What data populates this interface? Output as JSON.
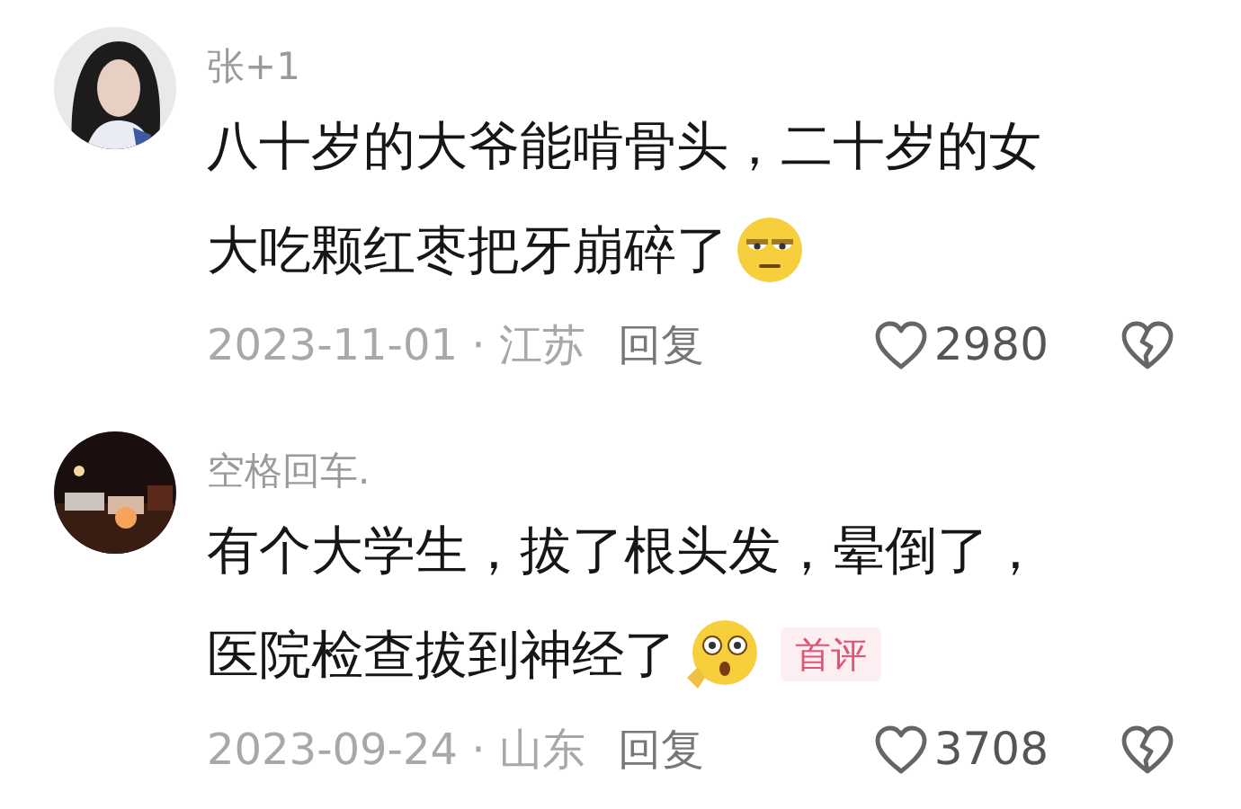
{
  "comments": [
    {
      "username": "张+1",
      "lines": [
        "八十岁的大爷能啃骨头，二十岁的女",
        "大吃颗红枣把牙崩碎了"
      ],
      "emoji": {
        "kind": "unamused"
      },
      "avatar": {
        "kind": "portrait"
      },
      "date": "2023-11-01 · 江苏",
      "reply": "回复",
      "likes": "2980"
    },
    {
      "username": "空格回车.",
      "lines": [
        "有个大学生，拔了根头发，晕倒了，",
        "医院检查拔到神经了"
      ],
      "emoji": {
        "kind": "shocked"
      },
      "tag": "首评",
      "avatar": {
        "kind": "night"
      },
      "date": "2023-09-24 · 山东",
      "reply": "回复",
      "likes": "3708"
    }
  ]
}
